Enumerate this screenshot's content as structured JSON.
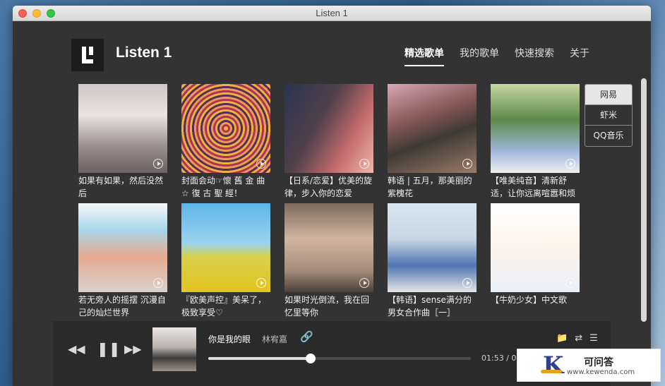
{
  "window": {
    "title": "Listen 1"
  },
  "header": {
    "app_name": "Listen 1",
    "nav": [
      {
        "label": "精选歌单",
        "active": true
      },
      {
        "label": "我的歌单",
        "active": false
      },
      {
        "label": "快速搜索",
        "active": false
      },
      {
        "label": "关于",
        "active": false
      }
    ]
  },
  "sources": [
    {
      "label": "网易",
      "active": true
    },
    {
      "label": "虾米",
      "active": false
    },
    {
      "label": "QQ音乐",
      "active": false
    }
  ],
  "playlists": [
    {
      "title": "如果有如果，然后没然后"
    },
    {
      "title": "封面会动☞懷 舊 金 曲 ☆ 復 古 聖 經！"
    },
    {
      "title": "【日系/恋爱】优美的旋律，步入你的恋爱"
    },
    {
      "title": "韩语 | 五月，那美丽的紫槐花"
    },
    {
      "title": "【唯美纯音】清新舒适，让你远离喧嚣和烦恼"
    },
    {
      "title": "若无旁人的摇摆 沉漫自己的灿烂世界"
    },
    {
      "title": "『欧美声控』美呆了，极致享受♡"
    },
    {
      "title": "如果时光倒流，我在回忆里等你"
    },
    {
      "title": "【韩语】sense满分的男女合作曲［一］"
    },
    {
      "title": "【牛奶少女】中文歌"
    }
  ],
  "player": {
    "track_title": "你是我的眼",
    "artist": "林宥嘉",
    "time": "01:53 / 0",
    "progress": 0.39,
    "icons": [
      "previous-icon",
      "pause-icon",
      "next-icon",
      "link-icon",
      "folder-icon",
      "shuffle-icon",
      "playlist-icon"
    ]
  },
  "watermark": {
    "logo_letter": "K",
    "name": "可问答",
    "url": "www.kewenda.com"
  }
}
